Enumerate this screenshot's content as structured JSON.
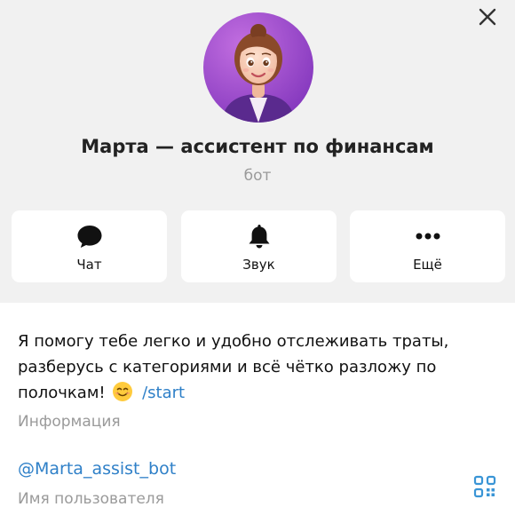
{
  "profile": {
    "name": "Марта — ассистент по финансам",
    "type": "бот"
  },
  "actions": [
    {
      "label": "Чат",
      "icon": "chat-bubble-icon"
    },
    {
      "label": "Звук",
      "icon": "bell-icon"
    },
    {
      "label": "Ещё",
      "icon": "more-dots-icon"
    }
  ],
  "info": {
    "description_text": "Я помогу тебе легко и удобно отслеживать траты, разберусь с категориями и всё чётко разложу по полочкам!",
    "emoji": "smiling-face",
    "command": "/start",
    "caption": "Информация"
  },
  "username": {
    "value": "@Marta_assist_bot",
    "caption": "Имя пользователя"
  },
  "colors": {
    "header_bg": "#f1f1f1",
    "link": "#2f80c8",
    "accent": "#3a95d6",
    "muted": "#9a9a9a"
  }
}
